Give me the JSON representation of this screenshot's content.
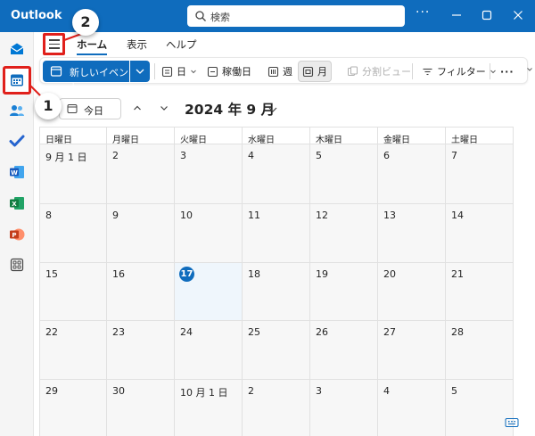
{
  "app": {
    "title": "Outlook"
  },
  "search": {
    "placeholder": "検索"
  },
  "window": {
    "more": "···"
  },
  "ribbon": {
    "tabs": [
      {
        "label": "ホーム",
        "active": true
      },
      {
        "label": "表示",
        "active": false
      },
      {
        "label": "ヘルプ",
        "active": false
      }
    ]
  },
  "toolbar": {
    "new_event": "新しいイベント",
    "day": "日",
    "work_week": "稼働日",
    "week": "週",
    "month": "月",
    "split_view": "分割ビュー",
    "filter": "フィルター",
    "more": "···"
  },
  "nav": {
    "today": "今日",
    "month_label": "2024 年 9 月"
  },
  "calendar": {
    "weekdays": [
      "日曜日",
      "月曜日",
      "火曜日",
      "水曜日",
      "木曜日",
      "金曜日",
      "土曜日"
    ],
    "weeks": [
      [
        "9 月 1 日",
        "2",
        "3",
        "4",
        "5",
        "6",
        "7"
      ],
      [
        "8",
        "9",
        "10",
        "11",
        "12",
        "13",
        "14"
      ],
      [
        "15",
        "16",
        "17",
        "18",
        "19",
        "20",
        "21"
      ],
      [
        "22",
        "23",
        "24",
        "25",
        "26",
        "27",
        "28"
      ],
      [
        "29",
        "30",
        "10 月 1 日",
        "2",
        "3",
        "4",
        "5"
      ]
    ],
    "today": "17"
  },
  "callouts": {
    "one": "1",
    "two": "2"
  },
  "colors": {
    "brand": "#0f6cbd",
    "highlight_box": "#e0201b",
    "mail": "#0078d4",
    "people": "#1a7fd4",
    "todo": "#2564cf",
    "word": "#185abd",
    "excel": "#107c41",
    "powerpoint": "#c43e1c"
  },
  "rail_icons": [
    "mail-icon",
    "calendar-icon",
    "people-icon",
    "todo-check-icon",
    "word-icon",
    "excel-icon",
    "powerpoint-icon",
    "apps-icon"
  ]
}
